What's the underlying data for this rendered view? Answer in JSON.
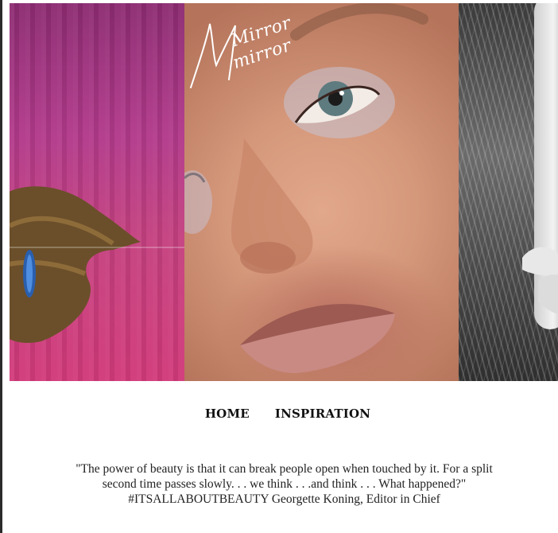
{
  "brand": {
    "logo_line1": "Mirror",
    "logo_line2": "mirror"
  },
  "hero": {
    "panels": [
      "pink-mirror-hand-photo",
      "face-closeup-photo",
      "black-white-grass-photo"
    ],
    "colors": {
      "pink": "#c4417f",
      "skin": "#d4977a",
      "grass": "#4a4a4a"
    }
  },
  "nav": {
    "items": [
      {
        "label": "HOME"
      },
      {
        "label": "INSPIRATION"
      }
    ]
  },
  "quote": {
    "line1": "\"The power of beauty is that it can break people open when touched by it. For a split",
    "line2": "second time passes slowly. . . we think . . .and think . . . What happened?\"",
    "line3": "#ITSALLABOUTBEAUTY Georgette Koning, Editor in Chief"
  }
}
